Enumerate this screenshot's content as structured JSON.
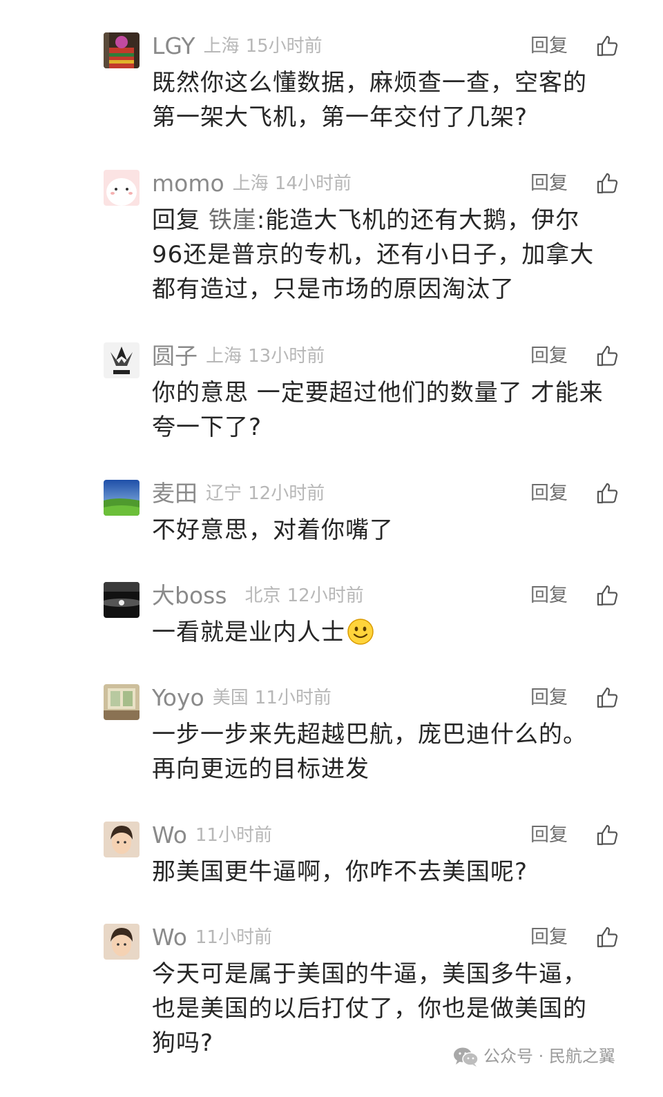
{
  "common": {
    "reply_label": "回复"
  },
  "comments": [
    {
      "name": "LGY",
      "location": "上海",
      "time": "15小时前",
      "text_lines": [
        "既然你这么懂数据，麻烦查一查，空客的",
        "第一架大飞机，第一年交付了几架?"
      ]
    },
    {
      "name": "momo",
      "location": "上海",
      "time": "14小时前",
      "reply_prefix": "回复",
      "mention": "铁崖",
      "text_first": ":能造大飞机的还有大鹅，伊尔",
      "text_lines": [
        "96还是普京的专机，还有小日子，加拿大",
        "都有造过，只是市场的原因淘汰了"
      ]
    },
    {
      "name": "圆子",
      "location": "上海",
      "time": "13小时前",
      "text_lines": [
        "你的意思 一定要超过他们的数量了 才能来",
        "夸一下了?"
      ]
    },
    {
      "name": "麦田",
      "location": "辽宁",
      "time": "12小时前",
      "text_lines": [
        "不好意思，对着你嘴了"
      ]
    },
    {
      "name": "大boss",
      "location": "北京",
      "time": "12小时前",
      "text_lines": [
        "一看就是业内人士"
      ]
    },
    {
      "name": "Yoyo",
      "location": "美国",
      "time": "11小时前",
      "text_lines": [
        "一步一步来先超越巴航，庞巴迪什么的。",
        "再向更远的目标进发"
      ]
    },
    {
      "name": "Wo",
      "location": "",
      "time": "11小时前",
      "text_lines": [
        "那美国更牛逼啊，你咋不去美国呢?"
      ]
    },
    {
      "name": "Wo",
      "location": "",
      "time": "11小时前",
      "text_lines": [
        "今天可是属于美国的牛逼，美国多牛逼，",
        "也是美国的以后打仗了，你也是做美国的",
        "狗吗?"
      ]
    }
  ],
  "watermark": {
    "text": "公众号 · 民航之翼",
    "icon": "wechat-icon"
  },
  "icons": {
    "like": "thumbs-up-icon",
    "emoji": "smiley-emoji"
  }
}
